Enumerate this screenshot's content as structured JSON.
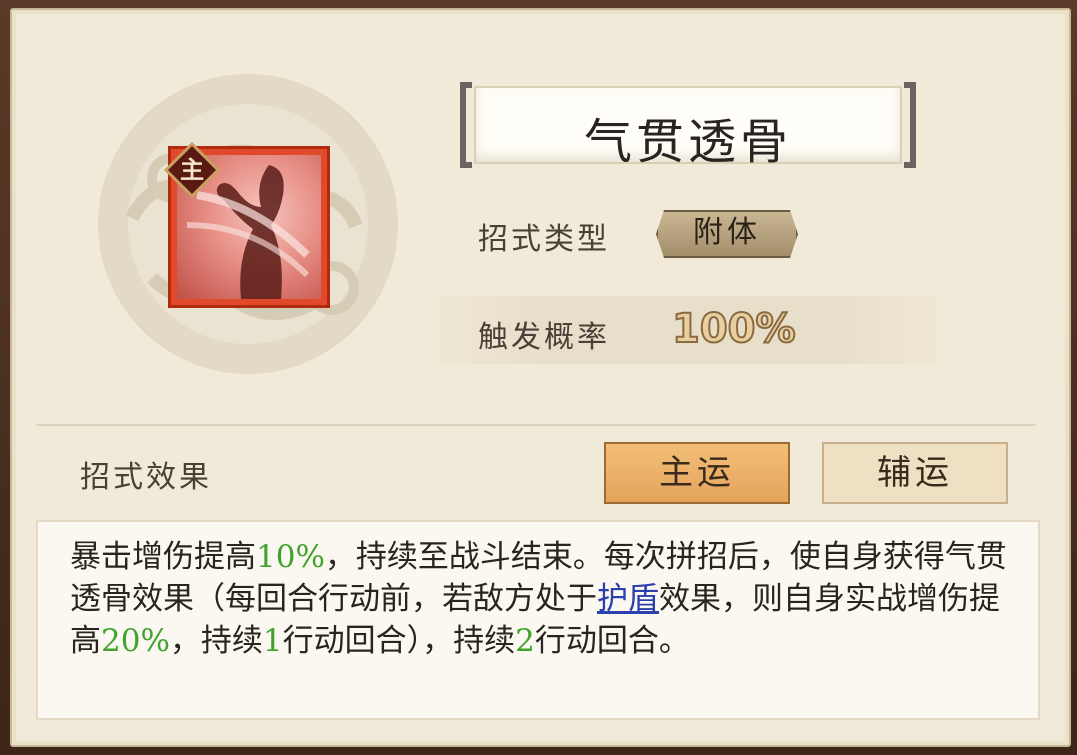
{
  "skill": {
    "name": "气贯透骨",
    "badge": "主",
    "type_label": "招式类型",
    "type_value": "附体",
    "prob_label": "触发概率",
    "prob_value": "100%"
  },
  "effect": {
    "label": "招式效果",
    "tabs": [
      "主运",
      "辅运"
    ],
    "active_tab": "主运",
    "segments": [
      {
        "text": "暴击增伤提高",
        "style": "normal"
      },
      {
        "text": "10%",
        "style": "green"
      },
      {
        "text": "，持续至战斗结束。每次拼招后，使自身获得气贯透骨效果（每回合行动前，若敌方处于",
        "style": "normal"
      },
      {
        "text": "护盾",
        "style": "link"
      },
      {
        "text": "效果，则自身实战增伤提高",
        "style": "normal"
      },
      {
        "text": "20%",
        "style": "green"
      },
      {
        "text": "，持续",
        "style": "normal"
      },
      {
        "text": "1",
        "style": "green"
      },
      {
        "text": "行动回合），持续",
        "style": "normal"
      },
      {
        "text": "2",
        "style": "green"
      },
      {
        "text": "行动回合。",
        "style": "normal"
      }
    ]
  },
  "colors": {
    "highlight_green": "#3fa32c",
    "link_blue": "#2c3fae",
    "active_tab": "#e9aa62"
  }
}
